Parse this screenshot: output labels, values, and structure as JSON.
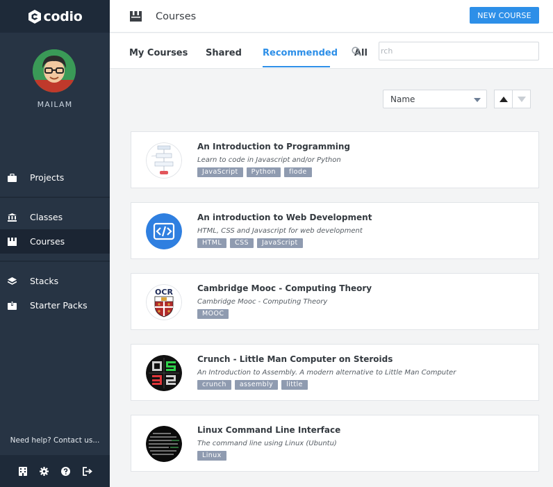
{
  "brand": {
    "name": "codio"
  },
  "user": {
    "name": "MAILAM"
  },
  "sidebar": {
    "items": [
      {
        "label": "Projects"
      },
      {
        "label": "Classes"
      },
      {
        "label": "Courses"
      },
      {
        "label": "Stacks"
      },
      {
        "label": "Starter Packs"
      }
    ],
    "help": "Need help? Contact us...",
    "active_index": 2
  },
  "header": {
    "title": "Courses",
    "new_course_label": "NEW COURSE"
  },
  "tabs": [
    {
      "label": "My Courses"
    },
    {
      "label": "Shared"
    },
    {
      "label": "Recommended"
    },
    {
      "label": "All"
    }
  ],
  "search": {
    "value": "",
    "placeholder": "rch"
  },
  "sort": {
    "selected": "Name"
  },
  "courses": [
    {
      "title": "An Introduction to Programming",
      "description": "Learn to code in Javascript and/or Python",
      "tags": [
        "JavaScript",
        "Python",
        "flode"
      ],
      "thumb_icon": "flowchart-icon"
    },
    {
      "title": "An introduction to Web Development",
      "description": "HTML, CSS and Javascript for web development",
      "tags": [
        "HTML",
        "CSS",
        "JavaScript"
      ],
      "thumb_icon": "code-icon"
    },
    {
      "title": "Cambridge Mooc - Computing Theory",
      "description": "Cambridge Mooc - Computing Theory",
      "tags": [
        "MOOC"
      ],
      "thumb_icon": "ocr-crest-icon"
    },
    {
      "title": "Crunch - Little Man Computer on Steroids",
      "description": "An Introduction to Assembly. A modern alternative to Little Man Computer",
      "tags": [
        "crunch",
        "assembly",
        "little"
      ],
      "thumb_icon": "led-display-icon"
    },
    {
      "title": "Linux Command Line Interface",
      "description": "The command line using Linux (Ubuntu)",
      "tags": [
        "Linux"
      ],
      "thumb_icon": "terminal-icon"
    }
  ],
  "colors": {
    "sidebar_bg": "#273444",
    "sidebar_dark": "#1e2a39",
    "accent": "#2d8fe8",
    "tag_bg": "#8f9bb0"
  }
}
